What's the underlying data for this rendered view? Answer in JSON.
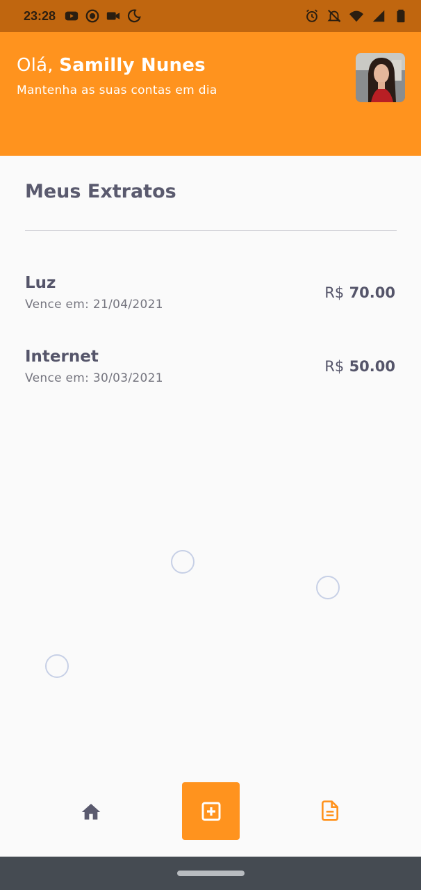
{
  "status_bar": {
    "time": "23:28",
    "left_icons": [
      "youtube-icon",
      "screen-record-icon",
      "video-camera-icon",
      "night-mode-icon"
    ],
    "right_icons": [
      "alarm-icon",
      "notifications-off-icon",
      "wifi-icon",
      "signal-icon",
      "battery-icon"
    ]
  },
  "header": {
    "greeting_prefix": "Olá, ",
    "user_name": "Samilly Nunes",
    "subtitle": "Mantenha as suas contas em dia",
    "background_color": "#FF931E"
  },
  "main": {
    "title": "Meus Extratos",
    "items": [
      {
        "title": "Luz",
        "due": "Vence em: 21/04/2021",
        "currency": "R$",
        "amount": "70.00"
      },
      {
        "title": "Internet",
        "due": "Vence em: 30/03/2021",
        "currency": "R$",
        "amount": "50.00"
      }
    ]
  },
  "bottom_nav": {
    "items": [
      "home-icon",
      "add-box-icon",
      "document-icon"
    ],
    "accent_color": "#FF931E"
  }
}
